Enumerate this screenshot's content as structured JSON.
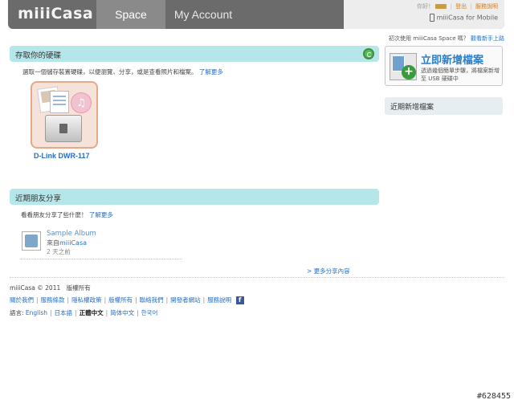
{
  "header": {
    "logo": "miiiCasa",
    "tabs": [
      {
        "label": "Space",
        "active": true
      },
      {
        "label": "My Account",
        "active": false
      }
    ],
    "greeting": "你好！",
    "logout_label": "登出",
    "help_label": "服務說明",
    "mobile_label": "miiiCasa for Mobile"
  },
  "intro": {
    "text": "初次使用 miiiCasa Space 嗎？",
    "link": "觀看新手上路"
  },
  "drive_section": {
    "title": "存取你的硬碟",
    "description": "選取一個儲存裝置硬碟，以便瀏覽、分享，或是查看照片和檔案。",
    "learn_more": "了解更多",
    "device_label": "D-Link DWR-117"
  },
  "friends_section": {
    "title": "近期朋友分享",
    "description": "看看朋友分享了些什麼！",
    "learn_more": "了解更多",
    "album": {
      "title": "Sample Album",
      "from_prefix": "來自",
      "from_name": "miiiCasa",
      "time": "2 天之前"
    },
    "more_link": "> 更多分享內容"
  },
  "sidebar": {
    "upload_title": "立即新增檔案",
    "upload_desc": "透過幾個簡單步驟，將檔案新增至 USB 硬碟中",
    "recent_title": "近期新增檔案"
  },
  "footer": {
    "copyright": "miiiCasa © 2011　版權所有",
    "links": [
      "關於我們",
      "服務條款",
      "隱私權政策",
      "版權所有",
      "聯絡我們",
      "開發者網站",
      "服務說明"
    ],
    "language_label": "語言:",
    "languages": [
      {
        "label": "English",
        "current": false
      },
      {
        "label": "日本語",
        "current": false
      },
      {
        "label": "正體中文",
        "current": true
      },
      {
        "label": "简体中文",
        "current": false
      },
      {
        "label": "한국어",
        "current": false
      }
    ]
  },
  "watermark": "#628455",
  "colors": {
    "header_bg": "#6b6b6b",
    "section_bar": "#b5e6ea",
    "link": "#2a6fbf"
  }
}
